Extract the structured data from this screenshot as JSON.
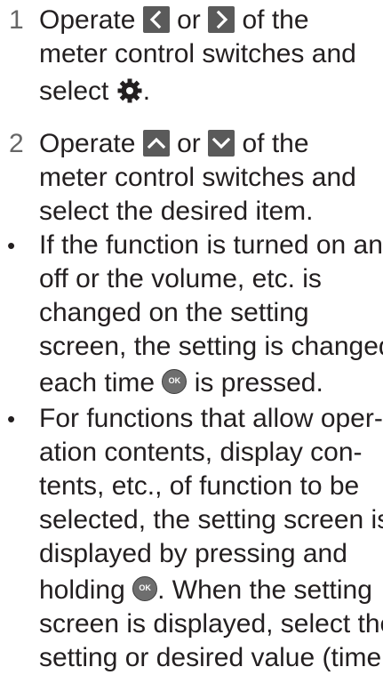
{
  "steps": [
    {
      "number": "1",
      "line1_a": "Operate",
      "line1_b": "or",
      "line1_c": "of the",
      "line2": "meter control switches and",
      "line3_a": "select",
      "line3_b": "."
    },
    {
      "number": "2",
      "line1_a": "Operate",
      "line1_b": "or",
      "line1_c": "of the",
      "line2": "meter control switches and",
      "line3": "select the desired item."
    }
  ],
  "notes": [
    {
      "bullet": "•",
      "lines": [
        "If the function is turned on and",
        "off or the volume, etc. is",
        "changed on the setting",
        "screen, the setting is changed"
      ],
      "last_a": "each time",
      "last_b": "is pressed."
    },
    {
      "bullet": "•",
      "lines": [
        "For functions that allow oper-",
        "ation contents, display con-",
        "tents, etc., of function to be",
        "selected, the setting screen is",
        "displayed by pressing and"
      ],
      "hold_a": "holding",
      "hold_b": ". When the setting",
      "after": [
        "screen is displayed, select the",
        "setting or desired value (time,"
      ]
    }
  ],
  "icons": {
    "left": "chevron-left-icon",
    "right": "chevron-right-icon",
    "up": "chevron-up-icon",
    "down": "chevron-down-icon",
    "gear": "gear-icon",
    "ok": "ok-button-icon",
    "ok_label": "OK",
    "key_color": "#5a5a5a",
    "text_color": "#231f20",
    "number_color": "#666666"
  }
}
